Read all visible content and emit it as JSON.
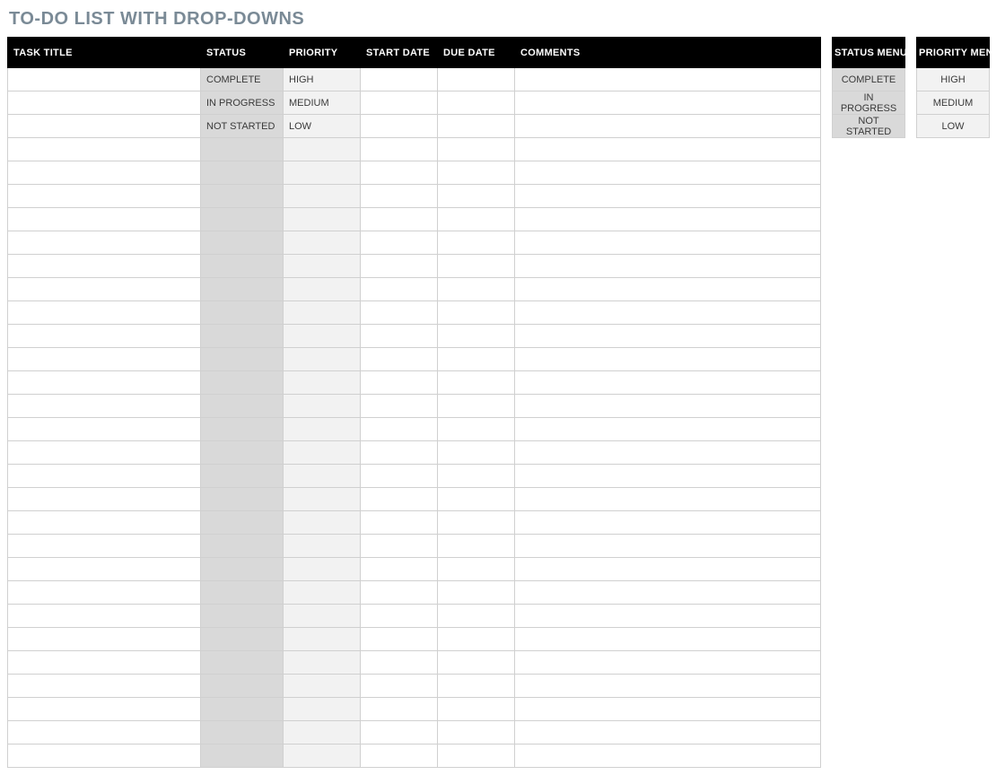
{
  "title": "TO-DO LIST WITH DROP-DOWNS",
  "main": {
    "headers": {
      "task_title": "TASK TITLE",
      "status": "STATUS",
      "priority": "PRIORITY",
      "start_date": "START DATE",
      "due_date": "DUE DATE",
      "comments": "COMMENTS"
    },
    "rows": [
      {
        "task_title": "",
        "status": "COMPLETE",
        "priority": "HIGH",
        "start_date": "",
        "due_date": "",
        "comments": ""
      },
      {
        "task_title": "",
        "status": "IN PROGRESS",
        "priority": "MEDIUM",
        "start_date": "",
        "due_date": "",
        "comments": ""
      },
      {
        "task_title": "",
        "status": "NOT STARTED",
        "priority": "LOW",
        "start_date": "",
        "due_date": "",
        "comments": ""
      },
      {
        "task_title": "",
        "status": "",
        "priority": "",
        "start_date": "",
        "due_date": "",
        "comments": ""
      },
      {
        "task_title": "",
        "status": "",
        "priority": "",
        "start_date": "",
        "due_date": "",
        "comments": ""
      },
      {
        "task_title": "",
        "status": "",
        "priority": "",
        "start_date": "",
        "due_date": "",
        "comments": ""
      },
      {
        "task_title": "",
        "status": "",
        "priority": "",
        "start_date": "",
        "due_date": "",
        "comments": ""
      },
      {
        "task_title": "",
        "status": "",
        "priority": "",
        "start_date": "",
        "due_date": "",
        "comments": ""
      },
      {
        "task_title": "",
        "status": "",
        "priority": "",
        "start_date": "",
        "due_date": "",
        "comments": ""
      },
      {
        "task_title": "",
        "status": "",
        "priority": "",
        "start_date": "",
        "due_date": "",
        "comments": ""
      },
      {
        "task_title": "",
        "status": "",
        "priority": "",
        "start_date": "",
        "due_date": "",
        "comments": ""
      },
      {
        "task_title": "",
        "status": "",
        "priority": "",
        "start_date": "",
        "due_date": "",
        "comments": ""
      },
      {
        "task_title": "",
        "status": "",
        "priority": "",
        "start_date": "",
        "due_date": "",
        "comments": ""
      },
      {
        "task_title": "",
        "status": "",
        "priority": "",
        "start_date": "",
        "due_date": "",
        "comments": ""
      },
      {
        "task_title": "",
        "status": "",
        "priority": "",
        "start_date": "",
        "due_date": "",
        "comments": ""
      },
      {
        "task_title": "",
        "status": "",
        "priority": "",
        "start_date": "",
        "due_date": "",
        "comments": ""
      },
      {
        "task_title": "",
        "status": "",
        "priority": "",
        "start_date": "",
        "due_date": "",
        "comments": ""
      },
      {
        "task_title": "",
        "status": "",
        "priority": "",
        "start_date": "",
        "due_date": "",
        "comments": ""
      },
      {
        "task_title": "",
        "status": "",
        "priority": "",
        "start_date": "",
        "due_date": "",
        "comments": ""
      },
      {
        "task_title": "",
        "status": "",
        "priority": "",
        "start_date": "",
        "due_date": "",
        "comments": ""
      },
      {
        "task_title": "",
        "status": "",
        "priority": "",
        "start_date": "",
        "due_date": "",
        "comments": ""
      },
      {
        "task_title": "",
        "status": "",
        "priority": "",
        "start_date": "",
        "due_date": "",
        "comments": ""
      },
      {
        "task_title": "",
        "status": "",
        "priority": "",
        "start_date": "",
        "due_date": "",
        "comments": ""
      },
      {
        "task_title": "",
        "status": "",
        "priority": "",
        "start_date": "",
        "due_date": "",
        "comments": ""
      },
      {
        "task_title": "",
        "status": "",
        "priority": "",
        "start_date": "",
        "due_date": "",
        "comments": ""
      },
      {
        "task_title": "",
        "status": "",
        "priority": "",
        "start_date": "",
        "due_date": "",
        "comments": ""
      },
      {
        "task_title": "",
        "status": "",
        "priority": "",
        "start_date": "",
        "due_date": "",
        "comments": ""
      },
      {
        "task_title": "",
        "status": "",
        "priority": "",
        "start_date": "",
        "due_date": "",
        "comments": ""
      },
      {
        "task_title": "",
        "status": "",
        "priority": "",
        "start_date": "",
        "due_date": "",
        "comments": ""
      },
      {
        "task_title": "",
        "status": "",
        "priority": "",
        "start_date": "",
        "due_date": "",
        "comments": ""
      }
    ]
  },
  "status_menu": {
    "header": "STATUS MENU",
    "items": [
      "COMPLETE",
      "IN PROGRESS",
      "NOT STARTED"
    ]
  },
  "priority_menu": {
    "header": "PRIORITY MENU",
    "items": [
      "HIGH",
      "MEDIUM",
      "LOW"
    ]
  }
}
